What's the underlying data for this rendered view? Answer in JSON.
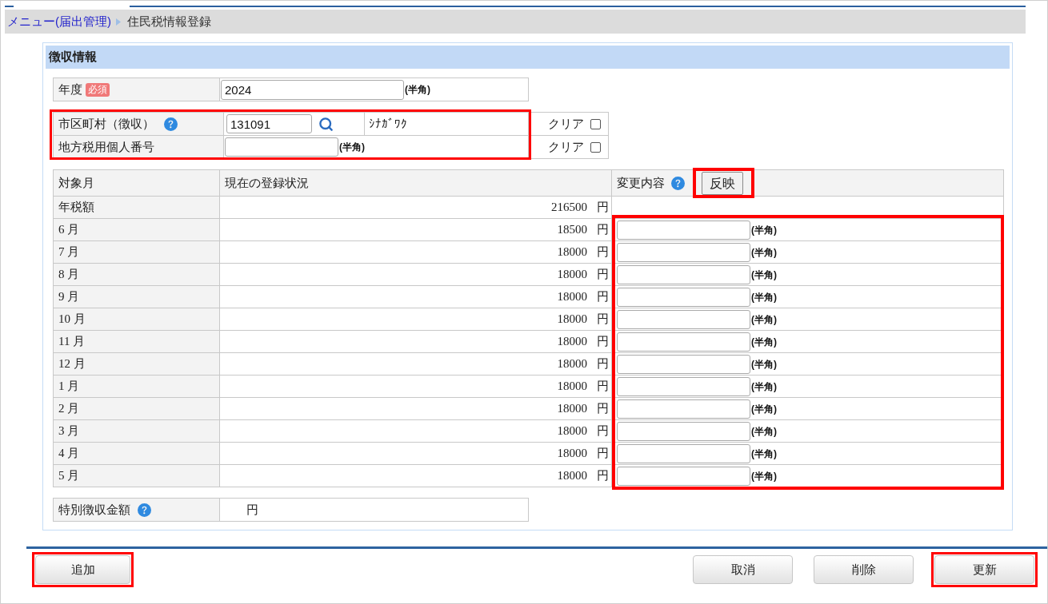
{
  "breadcrumb": {
    "parent": "メニュー(届出管理)",
    "current": "住民税情報登録"
  },
  "section_title": "徴収情報",
  "year": {
    "label": "年度",
    "badge": "必須",
    "value": "2024",
    "note": "(半角)"
  },
  "municipality_group": {
    "highlighted": true,
    "rows": [
      {
        "kind": "lookup",
        "label": "市区町村（徴収）",
        "help": true,
        "value": "131091",
        "reading": "ｼﾅｶﾞﾜｸ",
        "clear_label": "クリア",
        "clear_checked": false
      },
      {
        "kind": "text",
        "label": "地方税用個人番号",
        "help": false,
        "note": "(半角)",
        "clear_label": "クリア",
        "clear_checked": false
      }
    ]
  },
  "monthly_table": {
    "columns": [
      {
        "label": "対象月",
        "help": false
      },
      {
        "label": "現在の登録状況",
        "help": false
      },
      {
        "label": "変更内容",
        "help": true,
        "button": {
          "label": "反映",
          "highlighted": true
        }
      }
    ],
    "inputs_highlighted": true,
    "rows": [
      {
        "month": "年税額",
        "amount": "216500",
        "unit": "円",
        "editable": false
      },
      {
        "month": "6 月",
        "amount": "18500",
        "unit": "円",
        "editable": true,
        "note": "(半角)"
      },
      {
        "month": "7 月",
        "amount": "18000",
        "unit": "円",
        "editable": true,
        "note": "(半角)"
      },
      {
        "month": "8 月",
        "amount": "18000",
        "unit": "円",
        "editable": true,
        "note": "(半角)"
      },
      {
        "month": "9 月",
        "amount": "18000",
        "unit": "円",
        "editable": true,
        "note": "(半角)"
      },
      {
        "month": "10 月",
        "amount": "18000",
        "unit": "円",
        "editable": true,
        "note": "(半角)"
      },
      {
        "month": "11 月",
        "amount": "18000",
        "unit": "円",
        "editable": true,
        "note": "(半角)"
      },
      {
        "month": "12 月",
        "amount": "18000",
        "unit": "円",
        "editable": true,
        "note": "(半角)"
      },
      {
        "month": "1 月",
        "amount": "18000",
        "unit": "円",
        "editable": true,
        "note": "(半角)"
      },
      {
        "month": "2 月",
        "amount": "18000",
        "unit": "円",
        "editable": true,
        "note": "(半角)"
      },
      {
        "month": "3 月",
        "amount": "18000",
        "unit": "円",
        "editable": true,
        "note": "(半角)"
      },
      {
        "month": "4 月",
        "amount": "18000",
        "unit": "円",
        "editable": true,
        "note": "(半角)"
      },
      {
        "month": "5 月",
        "amount": "18000",
        "unit": "円",
        "editable": true,
        "note": "(半角)"
      }
    ]
  },
  "special_collection": {
    "label": "特別徴収金額",
    "help": true,
    "unit": "円"
  },
  "footer": {
    "left_buttons": [
      {
        "label": "追加",
        "highlighted": true
      }
    ],
    "right_buttons": [
      {
        "label": "取消",
        "highlighted": false
      },
      {
        "label": "削除",
        "highlighted": false
      },
      {
        "label": "更新",
        "highlighted": true
      }
    ]
  }
}
